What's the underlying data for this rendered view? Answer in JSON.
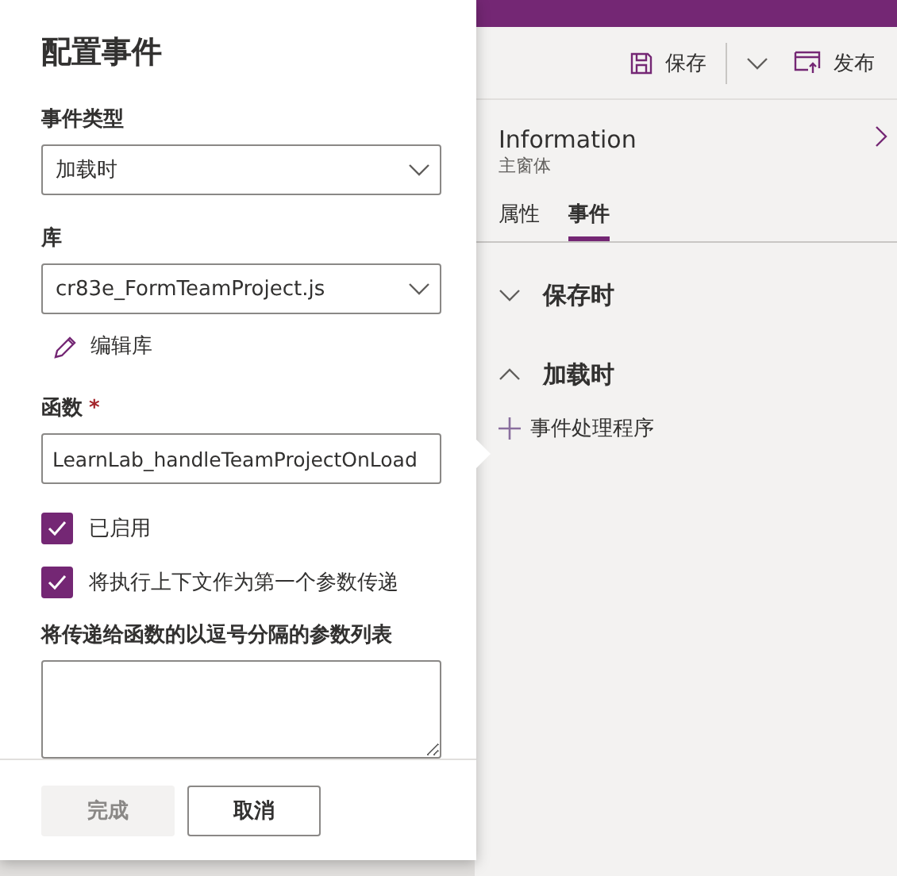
{
  "toolbar": {
    "buttons": [
      {
        "kind": "save",
        "label": "保存"
      },
      {
        "kind": "dropdown"
      },
      {
        "kind": "publish",
        "label": "发布"
      }
    ]
  },
  "panel": {
    "title": "Information",
    "subtitle": "主窗体",
    "tabs": [
      {
        "label": "属性",
        "selected": false
      },
      {
        "label": "事件",
        "selected": true
      }
    ],
    "sections": [
      {
        "label": "保存时",
        "expanded": false
      },
      {
        "label": "加载时",
        "expanded": true
      }
    ],
    "add_handler": "事件处理程序"
  },
  "dialog": {
    "title": "配置事件",
    "event_type": {
      "label": "事件类型",
      "value": "加载时"
    },
    "library": {
      "label": "库",
      "value": "cr83e_FormTeamProject.js"
    },
    "edit_library": "编辑库",
    "function": {
      "label": "函数",
      "required_mark": "*",
      "value": "LearnLab_handleTeamProjectOnLoad"
    },
    "checkboxes": [
      {
        "label": "已启用",
        "checked": true
      },
      {
        "label": "将执行上下文作为第一个参数传递",
        "checked": true
      }
    ],
    "parameters": {
      "label": "将传递给函数的以逗号分隔的参数列表"
    },
    "buttons": [
      {
        "label": "完成",
        "disabled": true
      },
      {
        "label": "取消",
        "disabled": false
      }
    ]
  }
}
